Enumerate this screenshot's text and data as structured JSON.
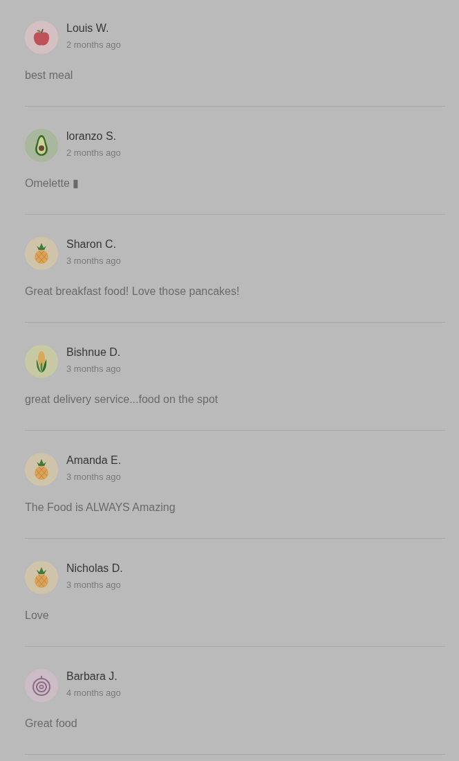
{
  "reviews": [
    {
      "avatar": {
        "kind": "apple"
      },
      "name": "Louis W.",
      "time": "2 months ago",
      "comment": "best meal"
    },
    {
      "avatar": {
        "kind": "avocado"
      },
      "name": "loranzo S.",
      "time": "2 months ago",
      "comment": "Omelette ▮"
    },
    {
      "avatar": {
        "kind": "pineapple"
      },
      "name": "Sharon C.",
      "time": "3 months ago",
      "comment": "Great breakfast food! Love those pancakes!"
    },
    {
      "avatar": {
        "kind": "corn"
      },
      "name": "Bishnue D.",
      "time": "3 months ago",
      "comment": "great delivery service...food on the spot"
    },
    {
      "avatar": {
        "kind": "pineapple"
      },
      "name": "Amanda E.",
      "time": "3 months ago",
      "comment": "The Food is ALWAYS Amazing"
    },
    {
      "avatar": {
        "kind": "pineapple"
      },
      "name": "Nicholas D.",
      "time": "3 months ago",
      "comment": "Love"
    },
    {
      "avatar": {
        "kind": "onion"
      },
      "name": "Barbara J.",
      "time": "4 months ago",
      "comment": "Great food"
    }
  ]
}
